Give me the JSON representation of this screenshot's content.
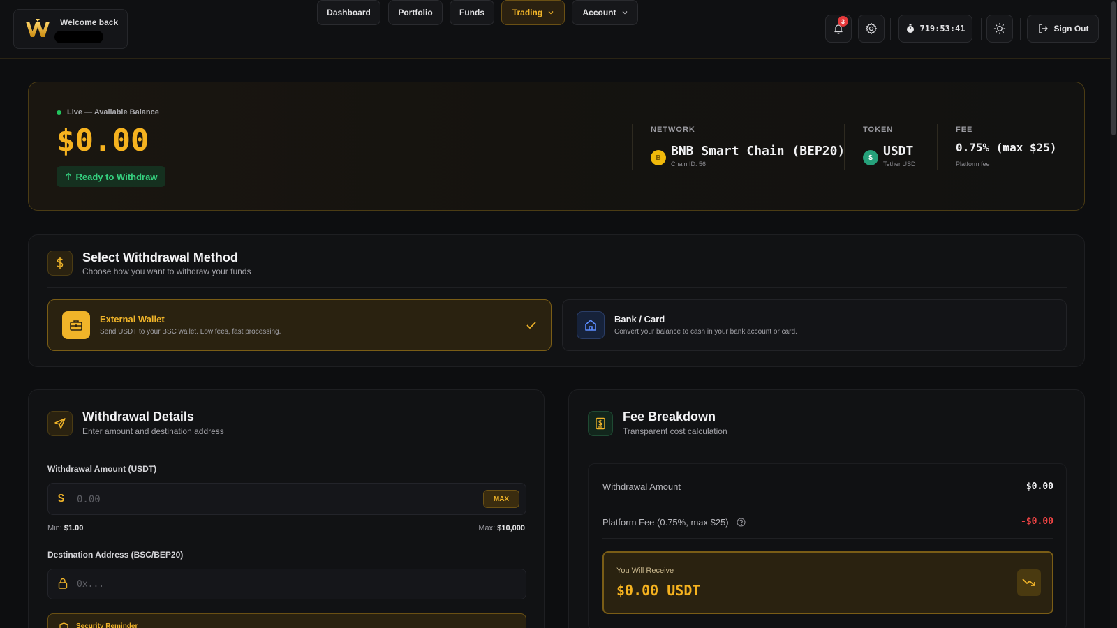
{
  "header": {
    "welcome": "Welcome back",
    "nav": [
      {
        "label": "Dashboard"
      },
      {
        "label": "Portfolio"
      },
      {
        "label": "Funds"
      },
      {
        "label": "Trading"
      },
      {
        "label": "Account"
      }
    ],
    "notification_count": "3",
    "timer": "719:53:41",
    "sign_out": "Sign Out"
  },
  "balance": {
    "status": "Live — Available Balance",
    "amount": "$0.00",
    "ready_label": "Ready to Withdraw",
    "network_label": "NETWORK",
    "network_value": "BNB Smart Chain (BEP20)",
    "network_sub": "Chain ID: 56",
    "token_label": "TOKEN",
    "token_value": "USDT",
    "token_sub": "Tether USD",
    "fee_label": "FEE",
    "fee_value": "0.75% (max $25)",
    "fee_sub": "Platform fee"
  },
  "method": {
    "title": "Select Withdrawal Method",
    "subtitle": "Choose how you want to withdraw your funds",
    "options": [
      {
        "title": "External Wallet",
        "desc": "Send USDT to your BSC wallet. Low fees, fast processing."
      },
      {
        "title": "Bank / Card",
        "desc": "Convert your balance to cash in your bank account or card."
      }
    ]
  },
  "details": {
    "title": "Withdrawal Details",
    "subtitle": "Enter amount and destination address",
    "amount_label": "Withdrawal Amount (USDT)",
    "amount_placeholder": "0.00",
    "max_label": "MAX",
    "min_label": "Min:",
    "min_value": "$1.00",
    "max_hint_label": "Max:",
    "max_value": "$10,000",
    "address_label": "Destination Address (BSC/BEP20)",
    "address_placeholder": "0x...",
    "security_title": "Security Reminder"
  },
  "fees": {
    "title": "Fee Breakdown",
    "subtitle": "Transparent cost calculation",
    "withdrawal_amount_label": "Withdrawal Amount",
    "withdrawal_amount_value": "$0.00",
    "platform_fee_label": "Platform Fee (0.75%, max $25)",
    "platform_fee_value": "-$0.00",
    "receive_label": "You Will Receive",
    "receive_value": "$0.00 USDT"
  },
  "colors": {
    "accent": "#f5b21f",
    "success": "#35d07f",
    "danger": "#e5393b",
    "background": "#0d0e10"
  }
}
